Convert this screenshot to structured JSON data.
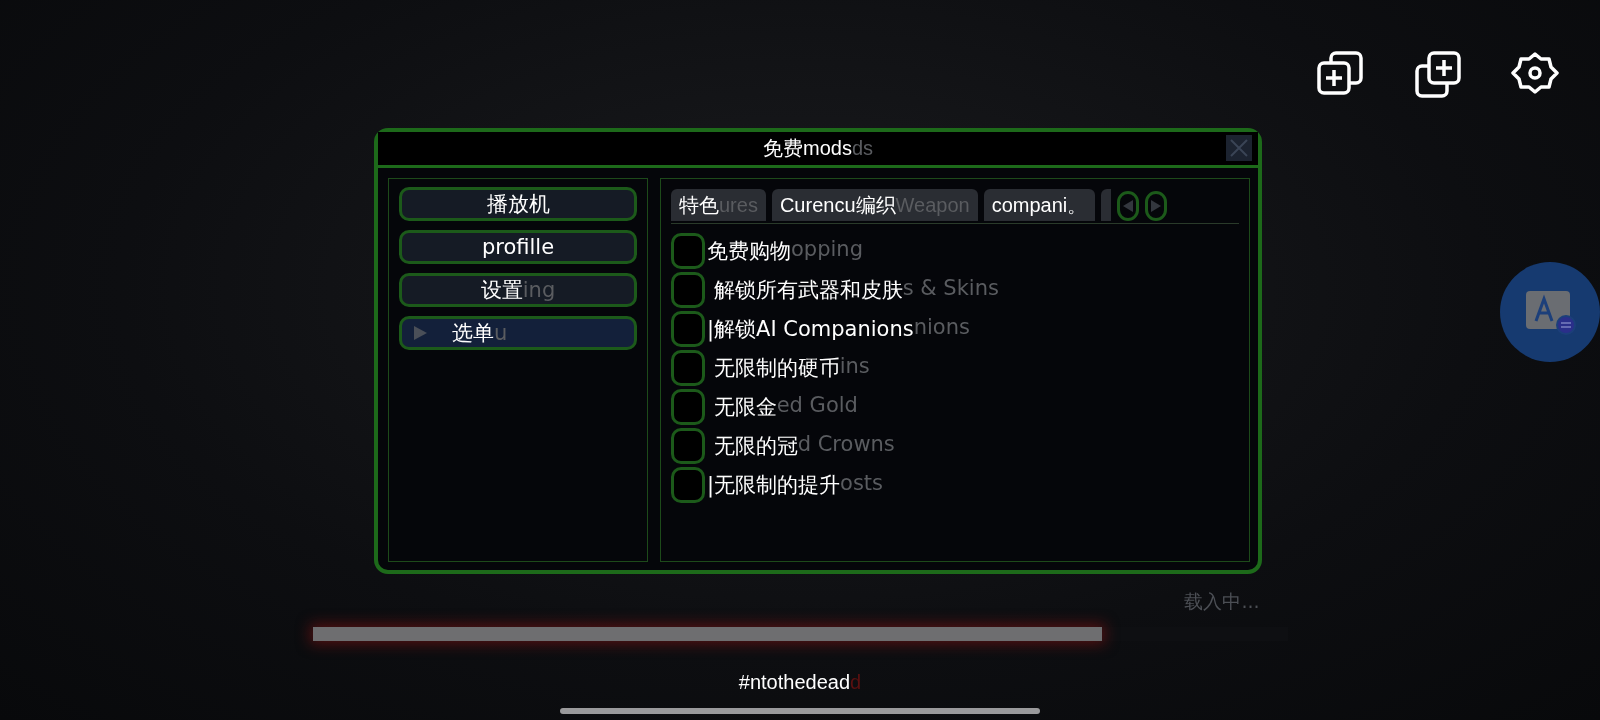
{
  "mod_menu": {
    "title": "免费mods",
    "title_underlay": "ds",
    "sidebar": [
      {
        "label": "播放机",
        "kind": "button",
        "selected": false
      },
      {
        "label": "profille",
        "kind": "button",
        "selected": false
      },
      {
        "label": "设置",
        "underlay": "ing",
        "kind": "button",
        "selected": false
      },
      {
        "label": "选单",
        "underlay": "u",
        "kind": "expander",
        "selected": true
      }
    ],
    "tabs": [
      {
        "label": "特色",
        "underlay": "ures",
        "selected": false
      },
      {
        "label": "Curencu编织",
        "underlay": "Weapon",
        "selected": false
      },
      {
        "label": "compani。",
        "selected": false
      }
    ],
    "options": [
      {
        "label": "免费购物",
        "underlay": "opping",
        "checked": false
      },
      {
        "label": " 解锁所有武器和皮肤",
        "underlay": "s & Skins",
        "checked": false
      },
      {
        "label": "|解锁AI Companions",
        "underlay": "nions",
        "checked": false
      },
      {
        "label": " 无限制的硬币",
        "underlay": "ins",
        "checked": false
      },
      {
        "label": " 无限金",
        "underlay": "ed Gold",
        "checked": false
      },
      {
        "label": " 无限的冠",
        "underlay": "d Crowns",
        "checked": false
      },
      {
        "label": "|无限制的提升",
        "underlay": "osts",
        "checked": false
      }
    ]
  },
  "loading": {
    "label": "载入中...",
    "level": 0.81
  },
  "hashtag": {
    "text": "#ntothedead",
    "underlay": "d"
  }
}
